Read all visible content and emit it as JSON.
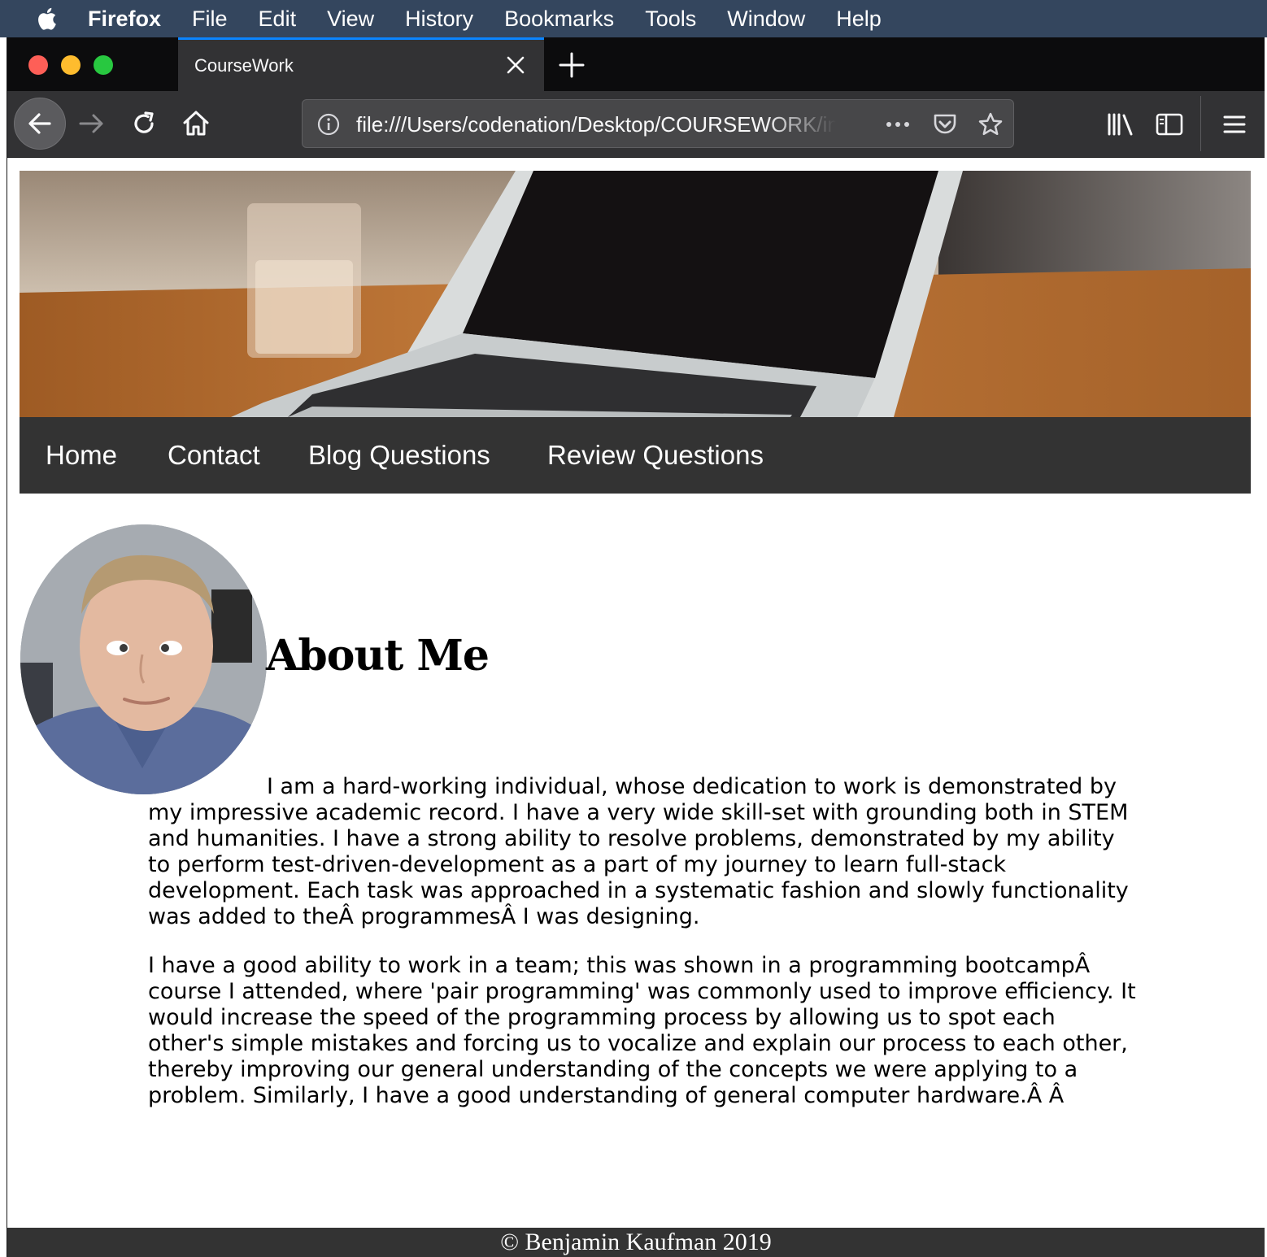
{
  "menubar": {
    "app_name": "Firefox",
    "items": [
      "File",
      "Edit",
      "View",
      "History",
      "Bookmarks",
      "Tools",
      "Window",
      "Help"
    ]
  },
  "browser": {
    "tab_title": "CourseWork",
    "url": "file:///Users/codenation/Desktop/COURSEWORK/index.html"
  },
  "site": {
    "nav": [
      "Home",
      "Contact",
      "Blog Questions",
      "Review Questions"
    ],
    "heading": "About Me",
    "paragraphs": [
      "I am a hard-working individual, whose dedication to work is demonstrated by my impressive academic record. I have a very wide skill-set with grounding both in STEM and humanities. I have a strong ability to resolve problems, demonstrated by my ability to perform test-driven-development as a part of my journey to learn full-stack development. Each task was approached in a systematic fashion and slowly functionality was added to theÂ programmesÂ I was designing.",
      "I have a good ability to work in a team; this was shown in a programming bootcampÂ course I attended, where 'pair programming' was commonly used to improve efficiency. It would increase the speed of the programming process by allowing us to spot each other's simple mistakes and forcing us to vocalize and explain our process to each other, thereby improving our general understanding of the concepts we were applying to a problem. Similarly, I have a good understanding of general computer hardware.Â Â"
    ],
    "footer": "© Benjamin Kaufman 2019"
  },
  "colors": {
    "menubar_bg": "#34465e",
    "tabbar_bg": "#0c0c0d",
    "toolbar_bg": "#323234",
    "tab_accent": "#0a84ff",
    "site_nav_bg": "#333333"
  },
  "icons": {
    "apple": "apple-icon",
    "tab_close": "close-icon",
    "new_tab": "plus-icon",
    "back": "arrow-left-icon",
    "forward": "arrow-right-icon",
    "reload": "reload-icon",
    "home": "home-icon",
    "site_info": "info-icon",
    "page_actions": "more-icon",
    "pocket": "pocket-icon",
    "bookmark": "star-icon",
    "library": "library-icon",
    "sidebar": "sidebar-icon",
    "menu": "hamburger-menu-icon"
  }
}
